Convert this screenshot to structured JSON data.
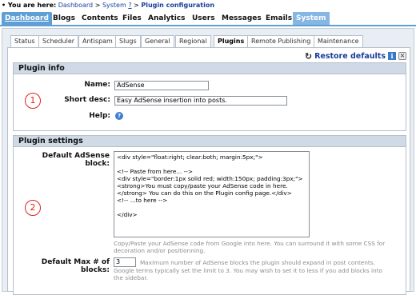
{
  "breadcrumb": {
    "prefix": "You are here:",
    "items": [
      "Dashboard",
      "System",
      "?",
      "Plugin configuration"
    ],
    "sep": ">"
  },
  "mainnav": [
    "Dashboard",
    "Blogs",
    "Contents",
    "Files",
    "Analytics",
    "Users",
    "Messages",
    "Emails",
    "System"
  ],
  "subtabs": [
    "Status",
    "Scheduler",
    "Antispam",
    "Slugs",
    "General",
    "Regional",
    "Plugins",
    "Remote Publishing",
    "Maintenance"
  ],
  "toolbar": {
    "restore_label": "Restore defaults",
    "info_glyph": "i",
    "close_glyph": "×",
    "refresh_glyph": "↻"
  },
  "plugin_info": {
    "title": "Plugin info",
    "name_label": "Name:",
    "name_value": "AdSense",
    "desc_label": "Short desc:",
    "desc_value": "Easy AdSense insertion into posts.",
    "help_label": "Help:",
    "help_glyph": "?"
  },
  "plugin_settings": {
    "title": "Plugin settings",
    "adsense_label": "Default AdSense\nblock:",
    "adsense_value": "<div style=\"float:right; clear:both; margin:5px;\">\n\n<!-- Paste from here... -->\n<div style=\"border:1px solid red; width:150px; padding:3px;\">\n<strong>You must copy/paste your AdSense code in here.\n</strong> You can do this on the Plugin config page.</div>\n<!-- ...to here -->\n\n</div>",
    "adsense_note": "Copy/Paste your AdSense code from Google into here. You can surround it with some CSS for\ndecoration and/or positionning.",
    "max_label": "Default Max # of\nblocks:",
    "max_value": "3",
    "max_note_inline": "Maximum number of AdSense blocks the plugin should expand in post contents.",
    "max_note": "Google terms typically set the limit to 3. You may wish to set it to less if you add blocks into\nthe sidebar."
  },
  "markers": [
    "1",
    "2"
  ],
  "colors": {
    "accent": "#5f9fd5",
    "link": "#1a3f9a",
    "marker": "#e0231e",
    "section_header": "#cfdae6"
  }
}
